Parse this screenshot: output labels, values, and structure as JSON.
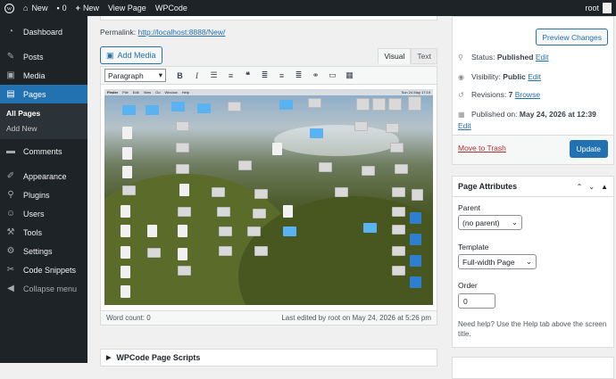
{
  "adminbar": {
    "site_name": "New",
    "comments_count": "0",
    "new_label": "New",
    "view_page": "View Page",
    "wpcode": "WPCode",
    "user": "root"
  },
  "sidebar": {
    "items": [
      {
        "label": "Dashboard",
        "icon": "dashboard-icon"
      },
      {
        "label": "Posts",
        "icon": "pin-icon"
      },
      {
        "label": "Media",
        "icon": "media-icon"
      },
      {
        "label": "Pages",
        "icon": "page-icon"
      },
      {
        "label": "Comments",
        "icon": "comment-icon"
      },
      {
        "label": "Appearance",
        "icon": "brush-icon"
      },
      {
        "label": "Plugins",
        "icon": "plugin-icon"
      },
      {
        "label": "Users",
        "icon": "user-icon"
      },
      {
        "label": "Tools",
        "icon": "wrench-icon"
      },
      {
        "label": "Settings",
        "icon": "settings-icon"
      },
      {
        "label": "Code Snippets",
        "icon": "code-icon"
      },
      {
        "label": "Collapse menu",
        "icon": "collapse-icon"
      }
    ],
    "submenu": [
      "All Pages",
      "Add New"
    ]
  },
  "editor": {
    "permalink_label": "Permalink:",
    "permalink_url": "http://localhost:8888/New/",
    "add_media": "Add Media",
    "tab_visual": "Visual",
    "tab_text": "Text",
    "format_select": "Paragraph",
    "word_count": "Word count: 0",
    "last_edited": "Last edited by root on May 24, 2026 at 5:26 pm"
  },
  "desktop_image": {
    "menubar": [
      "Finder",
      "File",
      "Edit",
      "View",
      "Go",
      "Window",
      "Help"
    ],
    "clock": "Sun 24 May 17:19"
  },
  "next_box": {
    "title": "WPCode Page Scripts"
  },
  "publish": {
    "preview": "Preview Changes",
    "status_label": "Status:",
    "status_value": "Published",
    "status_edit": "Edit",
    "visibility_label": "Visibility:",
    "visibility_value": "Public",
    "visibility_edit": "Edit",
    "revisions_label": "Revisions:",
    "revisions_value": "7",
    "revisions_link": "Browse",
    "published_on_label": "Published on:",
    "published_on_value": "May 24, 2026 at 12:39",
    "published_edit": "Edit",
    "trash": "Move to Trash",
    "update": "Update"
  },
  "attributes": {
    "title": "Page Attributes",
    "parent_label": "Parent",
    "parent_value": "(no parent)",
    "template_label": "Template",
    "template_value": "Full-width Page",
    "order_label": "Order",
    "order_value": "0",
    "help": "Need help? Use the Help tab above the screen title."
  }
}
